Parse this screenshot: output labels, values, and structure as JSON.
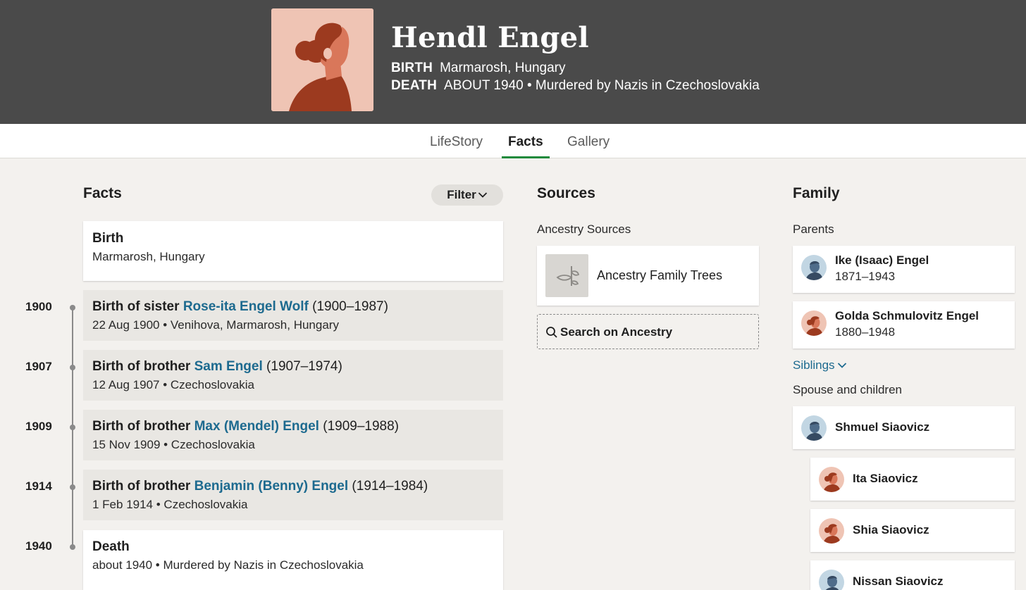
{
  "header": {
    "name": "Hendl Engel",
    "birth_label": "BIRTH",
    "birth_value": "Marmarosh, Hungary",
    "death_label": "DEATH",
    "death_value": "ABOUT 1940 • Murdered by Nazis in Czechoslovakia",
    "avatar_icon": "female-silhouette-icon"
  },
  "tabs": [
    {
      "label": "LifeStory"
    },
    {
      "label": "Facts",
      "active": true
    },
    {
      "label": "Gallery"
    }
  ],
  "facts": {
    "title": "Facts",
    "filter_label": "Filter",
    "items": [
      {
        "title": "Birth",
        "detail": "Marmarosh, Hungary"
      },
      {
        "year": "1900",
        "prefix": "Birth of sister ",
        "link": "Rose-ita Engel Wolf",
        "suffix": " (1900–1987)",
        "detail": "22 Aug 1900 • Venihova, Marmarosh, Hungary"
      },
      {
        "year": "1907",
        "prefix": "Birth of brother ",
        "link": "Sam Engel",
        "suffix": " (1907–1974)",
        "detail": "12 Aug 1907 • Czechoslovakia"
      },
      {
        "year": "1909",
        "prefix": "Birth of brother ",
        "link": "Max (Mendel) Engel",
        "suffix": " (1909–1988)",
        "detail": "15 Nov 1909 • Czechoslovakia"
      },
      {
        "year": "1914",
        "prefix": "Birth of brother ",
        "link": "Benjamin (Benny) Engel",
        "suffix": " (1914–1984)",
        "detail": "1 Feb 1914 • Czechoslovakia"
      },
      {
        "year": "1940",
        "title": "Death",
        "detail": "about 1940 • Murdered by Nazis in Czechoslovakia"
      }
    ]
  },
  "sources": {
    "title": "Sources",
    "subtitle": "Ancestry Sources",
    "card_label": "Ancestry Family Trees",
    "card_icon": "leaf-icon",
    "search_label": "Search on Ancestry"
  },
  "family": {
    "title": "Family",
    "parents_label": "Parents",
    "parents": [
      {
        "name": "Ike (Isaac) Engel",
        "years": "1871–1943",
        "gender": "male"
      },
      {
        "name": "Golda Schmulovitz Engel",
        "years": "1880–1948",
        "gender": "female"
      }
    ],
    "siblings_label": "Siblings",
    "spouse_label": "Spouse and children",
    "spouse": {
      "name": "Shmuel Siaovicz",
      "gender": "male"
    },
    "children": [
      {
        "name": "Ita Siaovicz",
        "gender": "female"
      },
      {
        "name": "Shia Siaovicz",
        "gender": "female"
      },
      {
        "name": "Nissan Siaovicz",
        "gender": "male"
      }
    ]
  },
  "colors": {
    "header_bg": "#4a4a4a",
    "tab_active_underline": "#1e8a3c",
    "link": "#1d6a8f",
    "page_bg": "#f3f1ee"
  }
}
